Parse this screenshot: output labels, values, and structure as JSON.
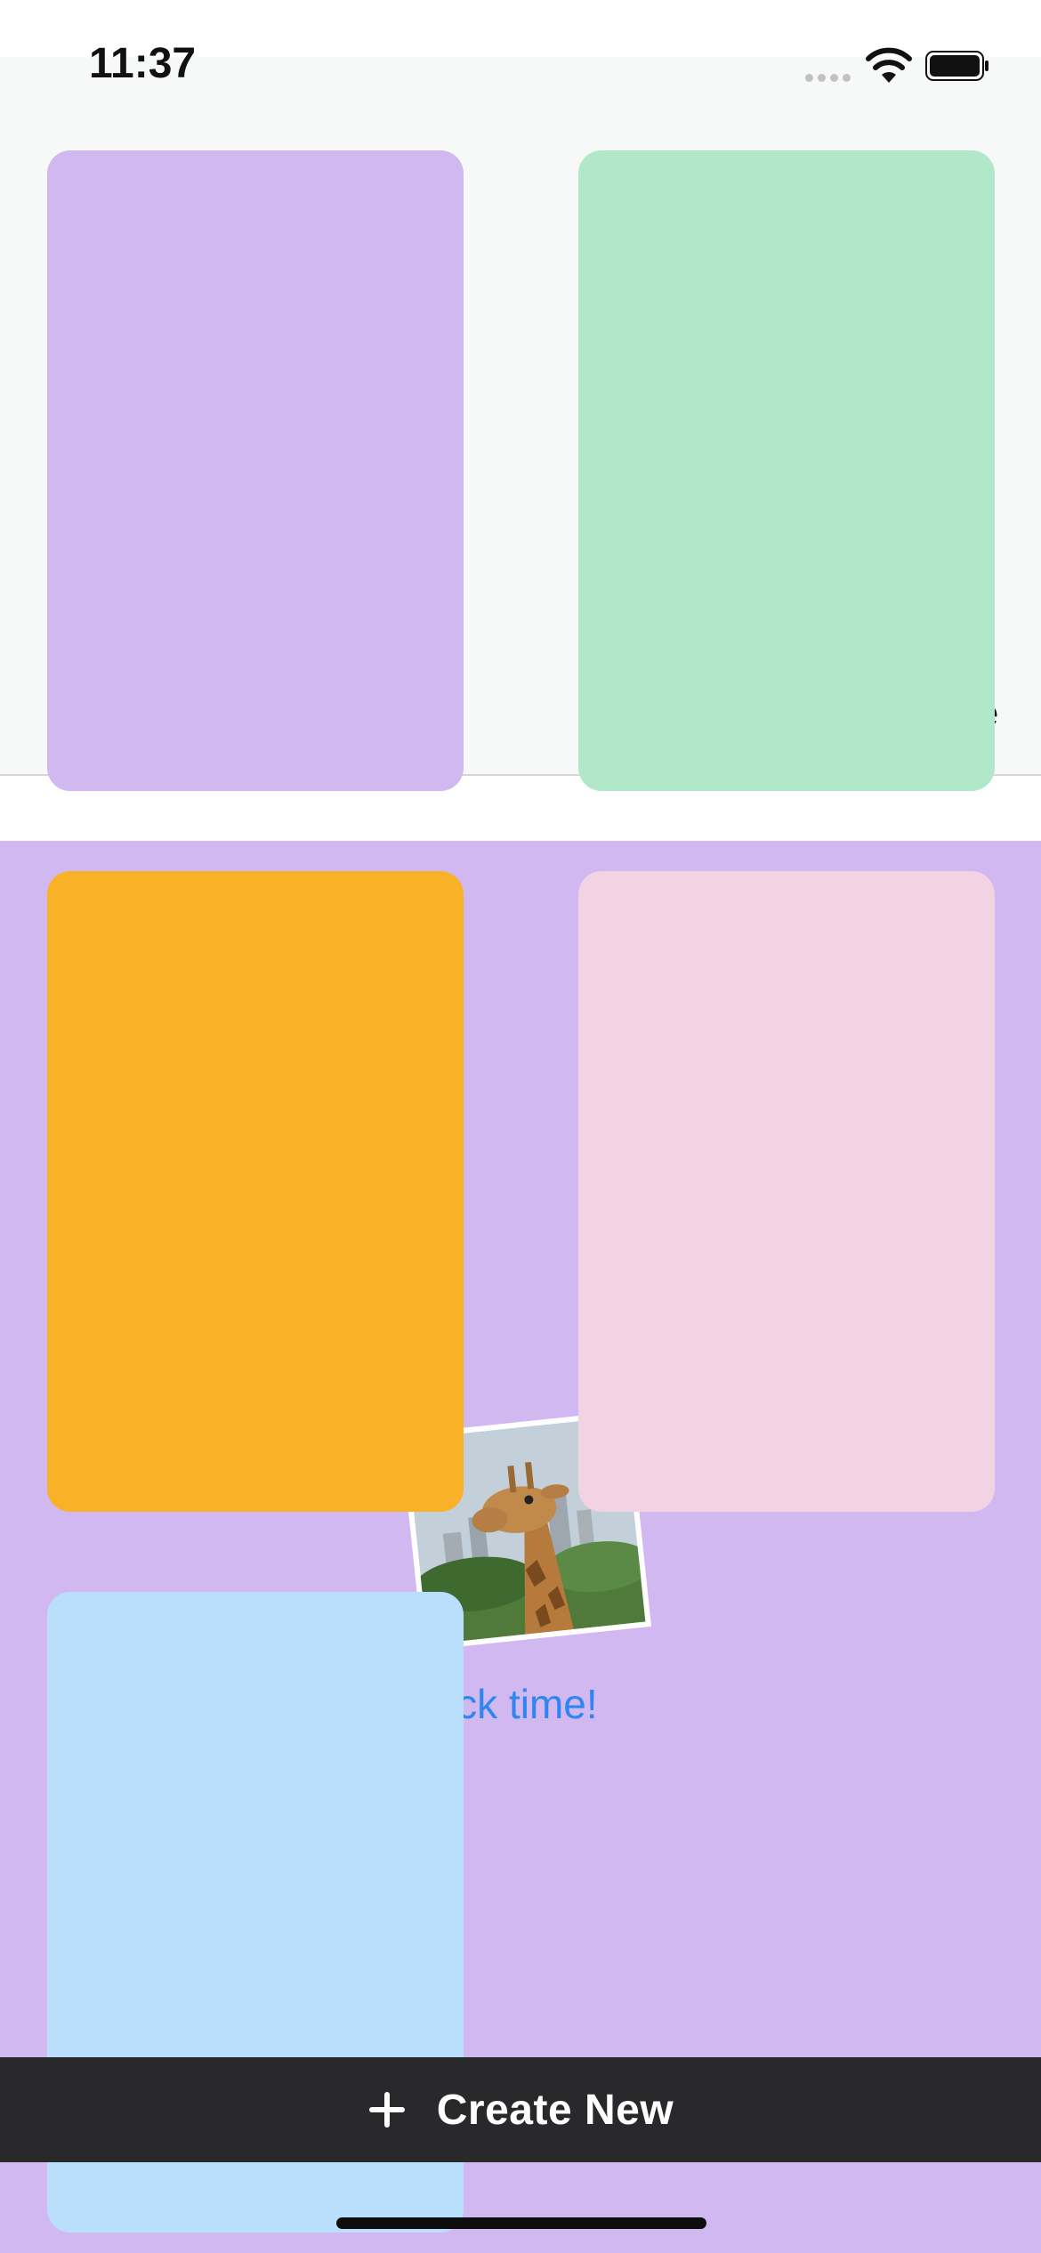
{
  "status_bar": {
    "time": "11:37"
  },
  "cards": {
    "purple": "#d1b8f0",
    "green": "#b1e8c9",
    "orange": "#f9b128",
    "pink": "#f1d3e4",
    "blue": "#b9dffc"
  },
  "background_fragment": {
    "partial_letter": "e",
    "caption": "nack time!"
  },
  "create_button": {
    "label": "Create New"
  },
  "icons": [
    "wifi-icon",
    "battery-icon",
    "plus-icon"
  ]
}
